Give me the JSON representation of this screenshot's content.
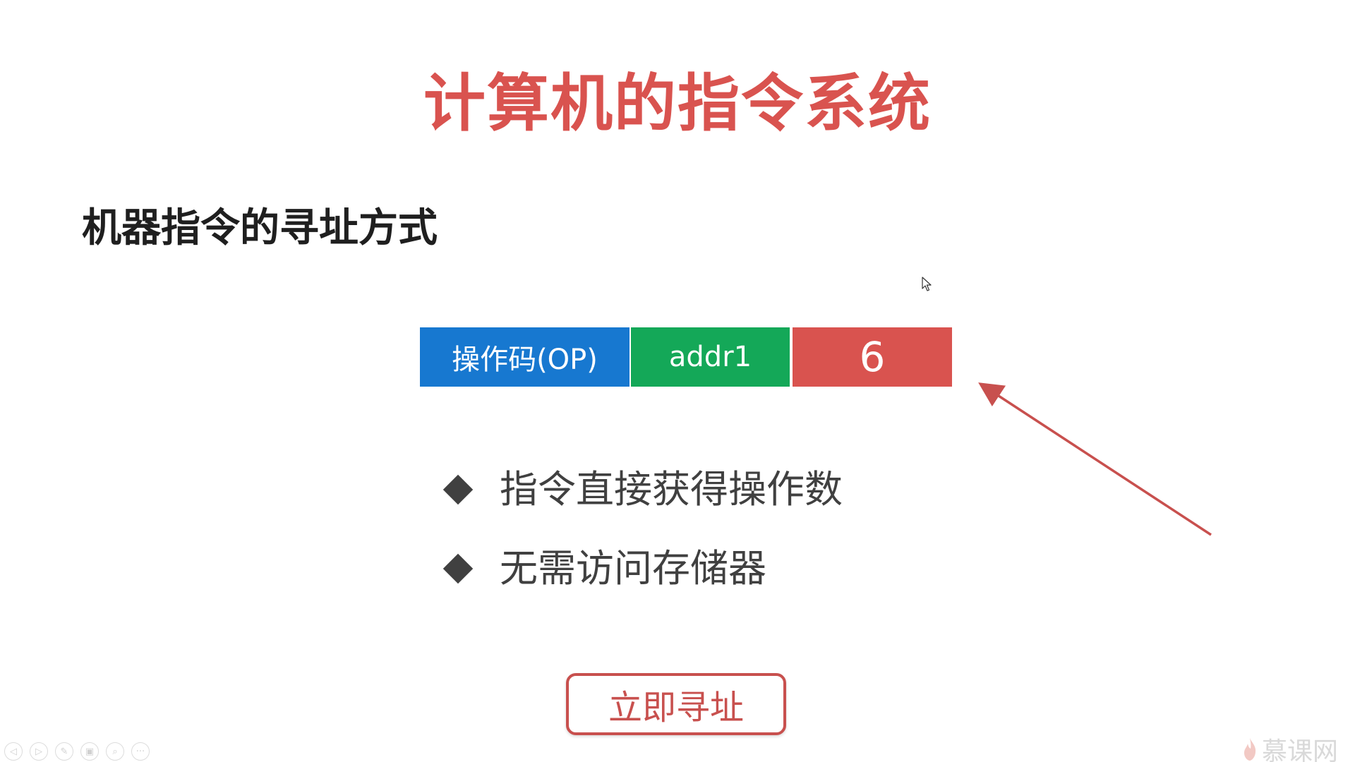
{
  "slide": {
    "title": "计算机的指令系统",
    "subtitle": "机器指令的寻址方式"
  },
  "instruction_format": {
    "fields": [
      {
        "label": "操作码(OP)",
        "color": "#1778d0"
      },
      {
        "label": "addr1",
        "color": "#14a858"
      },
      {
        "label": "6",
        "color": "#d9534f"
      }
    ]
  },
  "bullets": [
    {
      "text": "指令直接获得操作数"
    },
    {
      "text": "无需访问存储器"
    }
  ],
  "action_button": {
    "label": "立即寻址"
  },
  "presentation_toolbar": {
    "icons": [
      "previous-icon",
      "next-icon",
      "pen-icon",
      "slides-icon",
      "zoom-icon",
      "more-icon"
    ]
  },
  "watermark": {
    "text": "慕课网"
  },
  "colors": {
    "title": "#d9534f",
    "arrow": "#c8504e",
    "button_border": "#c8504e"
  }
}
